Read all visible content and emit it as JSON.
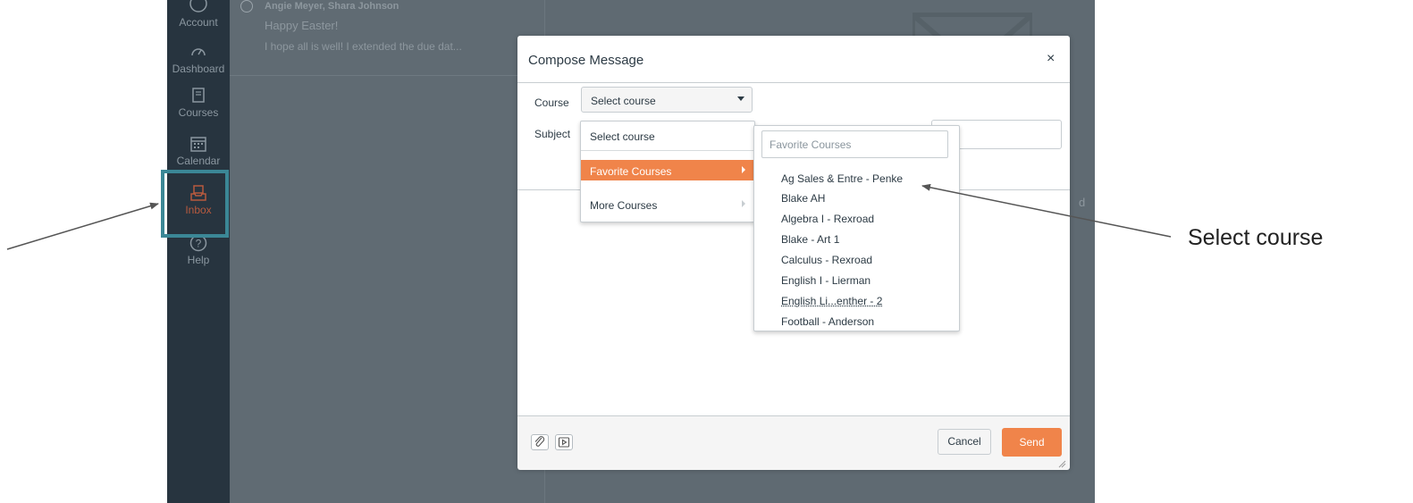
{
  "sidebar": {
    "items": [
      {
        "label": "Account",
        "icon": "account-icon"
      },
      {
        "label": "Dashboard",
        "icon": "dashboard-icon"
      },
      {
        "label": "Courses",
        "icon": "courses-icon"
      },
      {
        "label": "Calendar",
        "icon": "calendar-icon"
      },
      {
        "label": "Inbox",
        "icon": "inbox-icon"
      },
      {
        "label": "Help",
        "icon": "help-icon"
      }
    ],
    "active_color": "#b75a3f"
  },
  "message_list": {
    "from": "Angie Meyer, Shara Johnson",
    "subject": "Happy Easter!",
    "preview": "I hope all is well! I extended the due dat..."
  },
  "background": {
    "partial_text": "d"
  },
  "compose": {
    "title": "Compose Message",
    "close_symbol": "×",
    "course_label": "Course",
    "course_value": "Select course",
    "subject_label": "Subject",
    "course_menu": {
      "items": [
        "Select course",
        "Favorite Courses",
        "More Courses"
      ]
    },
    "favorites": {
      "filter_placeholder": "Favorite Courses",
      "courses": [
        "Ag Sales & Entre - Penke",
        "Blake AH",
        "Algebra I - Rexroad",
        "Blake - Art 1",
        "Calculus - Rexroad",
        "English I - Lierman",
        "English Li...enther - 2",
        "Football - Anderson"
      ]
    },
    "footer": {
      "attach_icon": "paperclip-icon",
      "media_icon": "media-icon",
      "cancel_label": "Cancel",
      "send_label": "Send"
    }
  },
  "colors": {
    "accent": "#f0844a",
    "highlight": "#3b8796",
    "sidebar": "#27343f"
  },
  "annotation": {
    "text": "Select course"
  }
}
